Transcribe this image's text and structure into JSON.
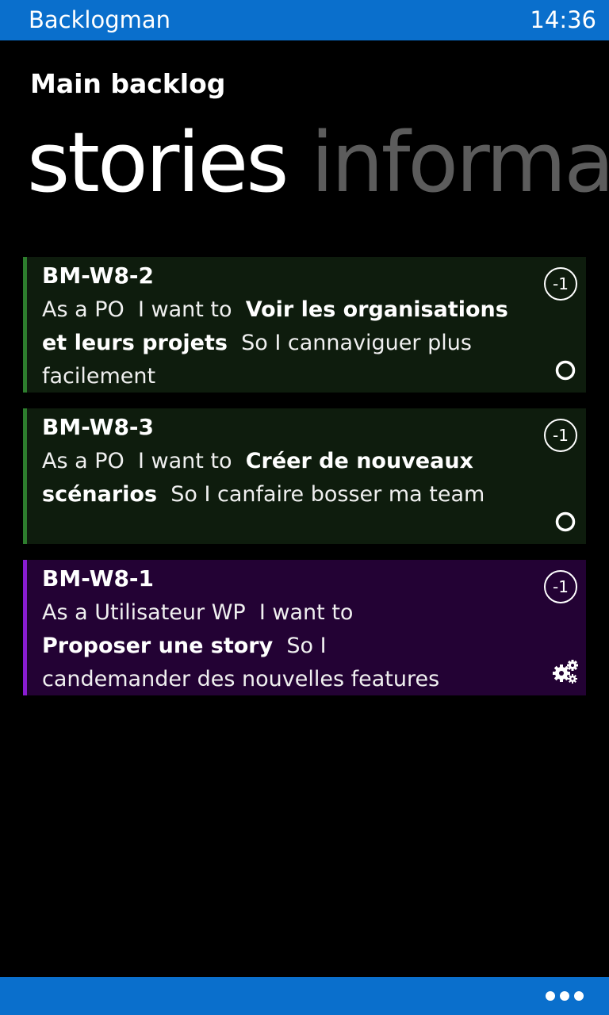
{
  "status_bar": {
    "app_name": "Backlogman",
    "clock": "14:36"
  },
  "page": {
    "header": "Main backlog",
    "pivots": [
      "stories",
      "informa"
    ]
  },
  "stories": [
    {
      "id": "BM-W8-2",
      "role_prefix": "As a PO",
      "want_prefix": "I want to",
      "goal": "Voir les organisations et leurs projets",
      "so_prefix": "So I",
      "benefit": "cannaviguer plus facilement",
      "badge": "-1",
      "status_icon": "circle-icon",
      "accent": "#2d7d2d"
    },
    {
      "id": "BM-W8-3",
      "role_prefix": "As a PO",
      "want_prefix": "I want to",
      "goal": "Créer de nouveaux scénarios",
      "so_prefix": "So I",
      "benefit": "canfaire bosser ma team",
      "badge": "-1",
      "status_icon": "circle-icon",
      "accent": "#2d7d2d"
    },
    {
      "id": "BM-W8-1",
      "role_prefix": "As a Utilisateur WP",
      "want_prefix": "I want to",
      "goal": "Proposer une story",
      "so_prefix": "So I",
      "benefit": "candemander des nouvelles features",
      "badge": "-1",
      "status_icon": "gears-icon",
      "accent": "#8a1cd2"
    }
  ],
  "app_bar": {
    "more_icon": "ellipsis-icon"
  },
  "colors": {
    "chrome_blue": "#0a6fcc",
    "inactive_pivot": "#5c5c5c",
    "green_card_bg": "#0e1c0d",
    "purple_card_bg": "#230234"
  }
}
